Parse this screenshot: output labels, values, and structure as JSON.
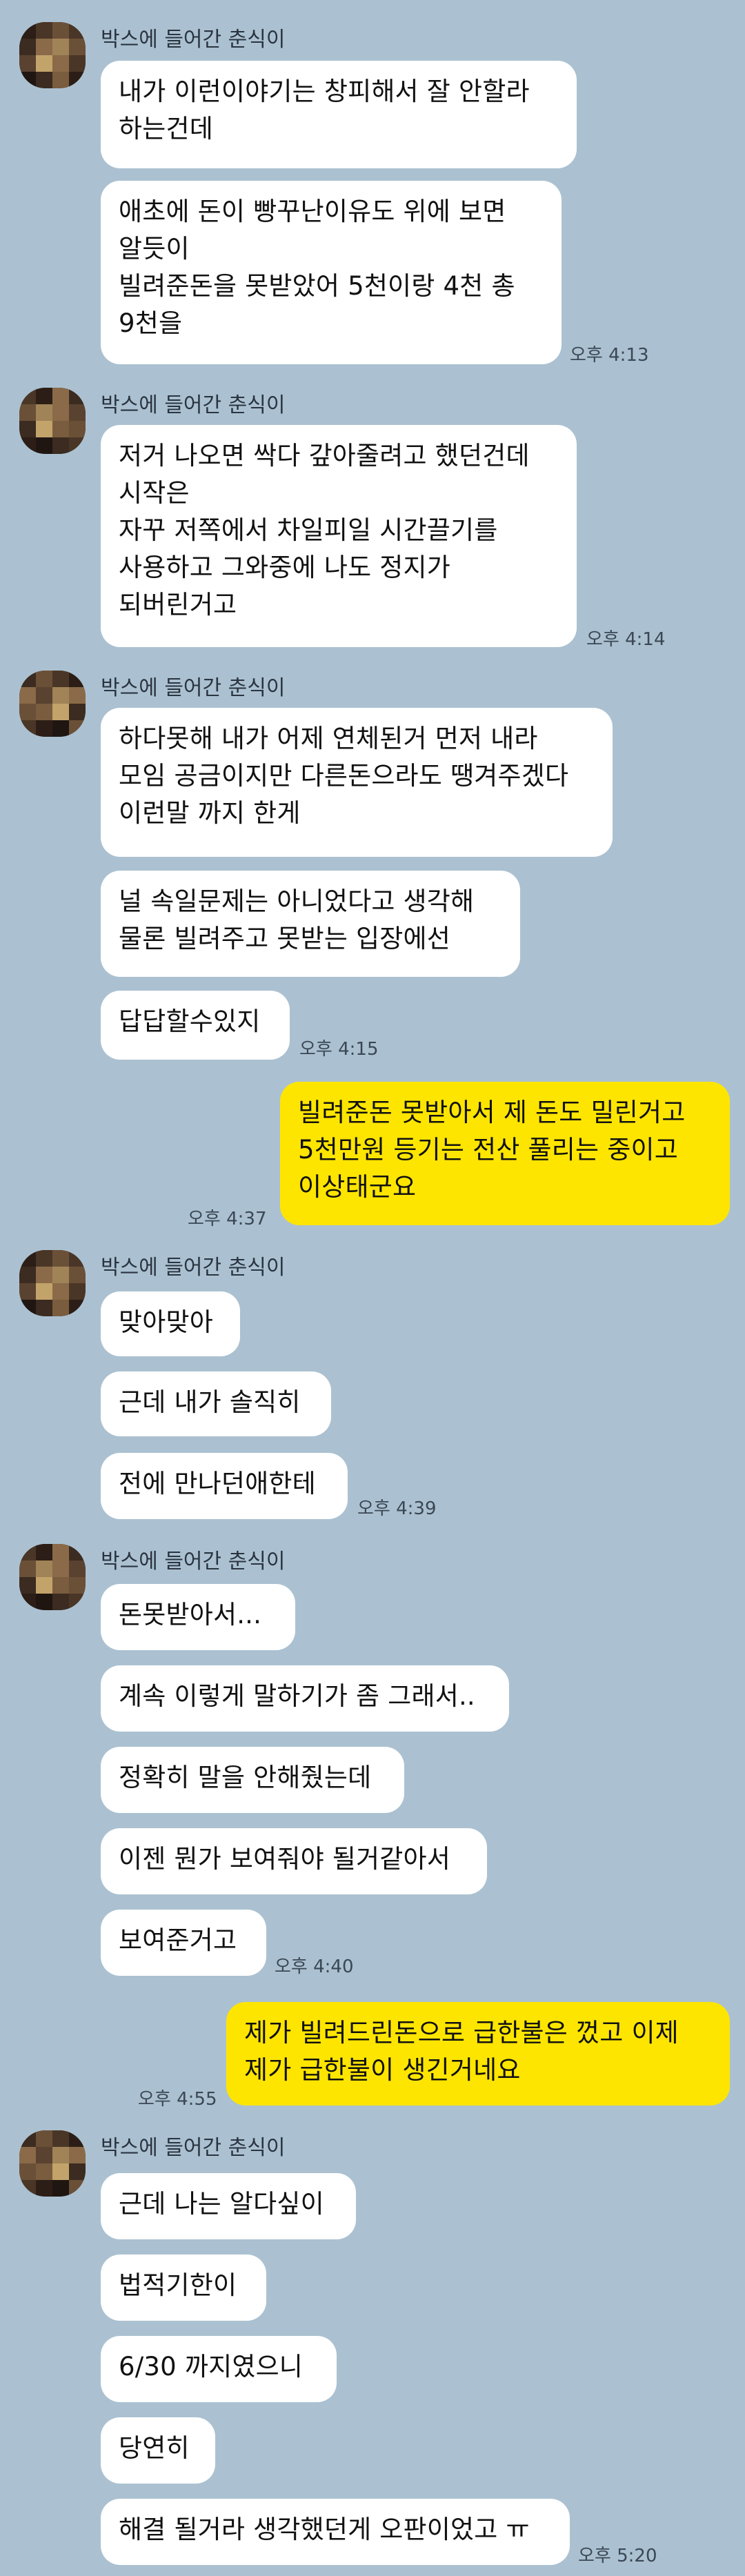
{
  "sender_name": "박스에 들어간 춘식이",
  "groups": [
    {
      "sender": "박스에 들어간 춘식이",
      "messages": [
        {
          "text": "내가 이런이야기는 창피해서 잘 안할라\n하는건데"
        },
        {
          "text": "애초에 돈이 빵꾸난이유도 위에 보면\n알듯이\n빌려준돈을 못받았어 5천이랑 4천 총\n9천을",
          "time": "오후 4:13"
        }
      ]
    },
    {
      "sender": "박스에 들어간 춘식이",
      "messages": [
        {
          "text": "저거 나오면 싹다 갚아줄려고 했던건데\n시작은\n자꾸 저쪽에서 차일피일 시간끌기를\n사용하고 그와중에 나도 정지가\n되버린거고",
          "time": "오후 4:14"
        }
      ]
    },
    {
      "sender": "박스에 들어간 춘식이",
      "messages": [
        {
          "text": "하다못해 내가 어제 연체된거 먼저 내라\n모임 공금이지만 다른돈으라도 땡겨주겠다\n이런말 까지 한게"
        },
        {
          "text": "널 속일문제는 아니었다고 생각해\n물론 빌려주고 못받는 입장에선"
        },
        {
          "text": "답답할수있지",
          "time": "오후 4:15"
        }
      ]
    },
    {
      "mine": true,
      "messages": [
        {
          "text": "빌려준돈 못받아서 제 돈도 밀린거고\n5천만원 등기는 전산 풀리는 중이고\n이상태군요",
          "time": "오후 4:37"
        }
      ]
    },
    {
      "sender": "박스에 들어간 춘식이",
      "messages": [
        {
          "text": "맞아맞아"
        },
        {
          "text": "근데 내가 솔직히"
        },
        {
          "text": "전에 만나던애한테",
          "time": "오후 4:39"
        }
      ]
    },
    {
      "sender": "박스에 들어간 춘식이",
      "messages": [
        {
          "text": "돈못받아서..."
        },
        {
          "text": "계속 이렇게 말하기가 좀 그래서.."
        },
        {
          "text": "정확히 말을 안해줬는데"
        },
        {
          "text": "이젠 뭔가 보여줘야 될거같아서"
        },
        {
          "text": "보여준거고",
          "time": "오후 4:40"
        }
      ]
    },
    {
      "mine": true,
      "messages": [
        {
          "text": "제가 빌려드린돈으로 급한불은 껐고 이제\n제가 급한불이 생긴거네요",
          "time": "오후 4:55"
        }
      ]
    },
    {
      "sender": "박스에 들어간 춘식이",
      "messages": [
        {
          "text": "근데 나는 알다싶이"
        },
        {
          "text": "법적기한이"
        },
        {
          "text": "6/30 까지였으니"
        },
        {
          "text": "당연히"
        },
        {
          "text": "해결 될거라 생각했던게 오판이었고 ㅠ",
          "time": "오후 5:20"
        }
      ]
    }
  ]
}
